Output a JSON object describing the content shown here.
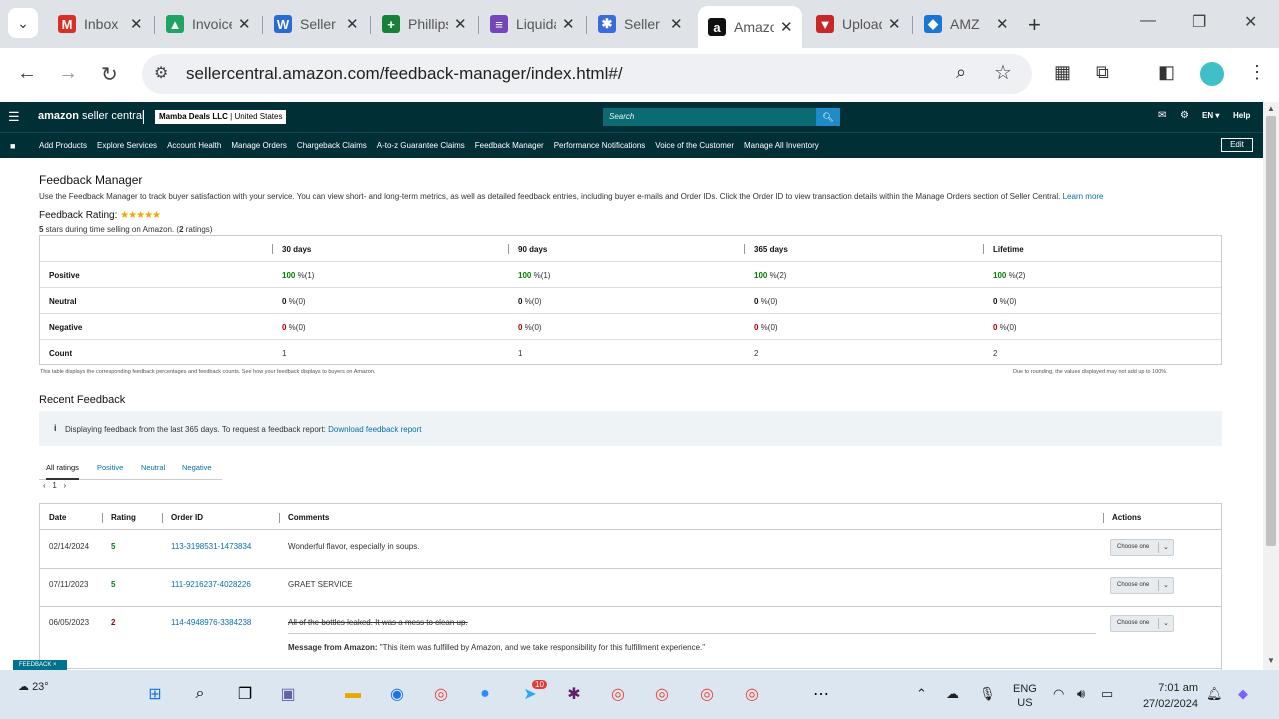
{
  "browser": {
    "tabs": [
      {
        "label": "Inbox",
        "icon": "gmail-icon",
        "color": "#d93025",
        "glyph": "M"
      },
      {
        "label": "Invoices",
        "icon": "google-drive-icon",
        "color": "#1fa463",
        "glyph": "▲"
      },
      {
        "label": "Seller",
        "icon": "seller-app-icon",
        "color": "#2a6bd1",
        "glyph": "W"
      },
      {
        "label": "Phillips",
        "icon": "sheets-icon",
        "color": "#188038",
        "glyph": "+"
      },
      {
        "label": "Liquidation",
        "icon": "forms-icon",
        "color": "#7248b9",
        "glyph": "≡"
      },
      {
        "label": "Seller",
        "icon": "asterisk-icon",
        "color": "#3b6bd9",
        "glyph": "✱"
      },
      {
        "label": "Amazon",
        "icon": "amazon-icon",
        "color": "#111111",
        "glyph": "a"
      },
      {
        "label": "Upload",
        "icon": "upload-app-icon",
        "color": "#c62828",
        "glyph": "▼"
      },
      {
        "label": "AMZ",
        "icon": "amz-tool-icon",
        "color": "#1976d2",
        "glyph": "◆"
      }
    ],
    "url": "sellercentral.amazon.com/feedback-manager/index.html#/"
  },
  "header": {
    "logo_main": "amazon",
    "logo_sub": " seller central",
    "account_name": "Mamba Deals LLC",
    "account_region": "United States",
    "search_placeholder": "Search",
    "language": "EN ▾",
    "help": "Help"
  },
  "nav": {
    "items": [
      "Add Products",
      "Explore Services",
      "Account Health",
      "Manage Orders",
      "Chargeback Claims",
      "A-to-z Guarantee Claims",
      "Feedback Manager",
      "Performance Notifications",
      "Voice of the Customer",
      "Manage All Inventory"
    ],
    "edit": "Edit"
  },
  "page": {
    "title": "Feedback Manager",
    "intro": "Use the Feedback Manager to track buyer satisfaction with your service. You can view short- and long-term metrics, as well as detailed feedback entries, including buyer e-mails and Order IDs. Click the Order ID to view transaction details within the Manage Orders section of Seller Central.",
    "learn_more": "Learn more",
    "rating_label": "Feedback Rating:",
    "stars": "★★★★★",
    "rating_sub_a": "5",
    "rating_sub_b": " stars during time selling on Amazon. (",
    "rating_sub_c": "2",
    "rating_sub_d": " ratings)"
  },
  "metrics": {
    "columns": [
      "30 days",
      "90 days",
      "365 days",
      "Lifetime"
    ],
    "rows": [
      {
        "label": "Positive",
        "cells": [
          {
            "v": "100",
            "s": " %(1)"
          },
          {
            "v": "100",
            "s": " %(1)"
          },
          {
            "v": "100",
            "s": " %(2)"
          },
          {
            "v": "100",
            "s": " %(2)"
          }
        ]
      },
      {
        "label": "Neutral",
        "cells": [
          {
            "v": "0",
            "s": " %(0)"
          },
          {
            "v": "0",
            "s": " %(0)"
          },
          {
            "v": "0",
            "s": " %(0)"
          },
          {
            "v": "0",
            "s": " %(0)"
          }
        ]
      },
      {
        "label": "Negative",
        "cells": [
          {
            "v": "0",
            "s": " %(0)"
          },
          {
            "v": "0",
            "s": " %(0)"
          },
          {
            "v": "0",
            "s": " %(0)"
          },
          {
            "v": "0",
            "s": " %(0)"
          }
        ]
      },
      {
        "label": "Count",
        "cells": [
          {
            "v": "",
            "s": "1"
          },
          {
            "v": "",
            "s": "1"
          },
          {
            "v": "",
            "s": "2"
          },
          {
            "v": "",
            "s": "2"
          }
        ]
      }
    ],
    "note_left": "This table displays the corresponding feedback percentages and feedback counts. See how your feedback displays to buyers on Amazon.",
    "note_right": "Due to rounding, the values displayed may not add up to 100%."
  },
  "recent": {
    "title": "Recent Feedback",
    "info_text": "Displaying feedback from the last 365 days. To request a feedback report:",
    "info_link": "Download feedback report",
    "filter_tabs": [
      "All ratings",
      "Positive",
      "Neutral",
      "Negative"
    ],
    "page_number": "1",
    "columns": [
      "Date",
      "Rating",
      "Order ID",
      "Comments",
      "Actions"
    ],
    "rows": [
      {
        "date": "02/14/2024",
        "rating": "5",
        "order_id": "113-3198531-1473834",
        "comment": "Wonderful flavor, especially in soups.",
        "action": "Choose one"
      },
      {
        "date": "07/11/2023",
        "rating": "5",
        "order_id": "111-9216237-4028226",
        "comment": "GRAET SERVICE",
        "action": "Choose one"
      },
      {
        "date": "06/05/2023",
        "rating": "2",
        "order_id": "114-4948976-3384238",
        "comment": "All of the bottles leaked. It was a mess to clean up.",
        "action": "Choose one",
        "amazon_label": "Message from Amazon:",
        "amazon_msg": " \"This item was fulfilled by Amazon, and we take responsibility for this fulfillment experience.\""
      }
    ],
    "feedback_badge": "FEEDBACK ×"
  },
  "taskbar": {
    "temperature": "23°",
    "lang_1": "ENG",
    "lang_2": "US",
    "time": "7:01 am",
    "date": "27/02/2024",
    "telegram_badge": "10"
  }
}
